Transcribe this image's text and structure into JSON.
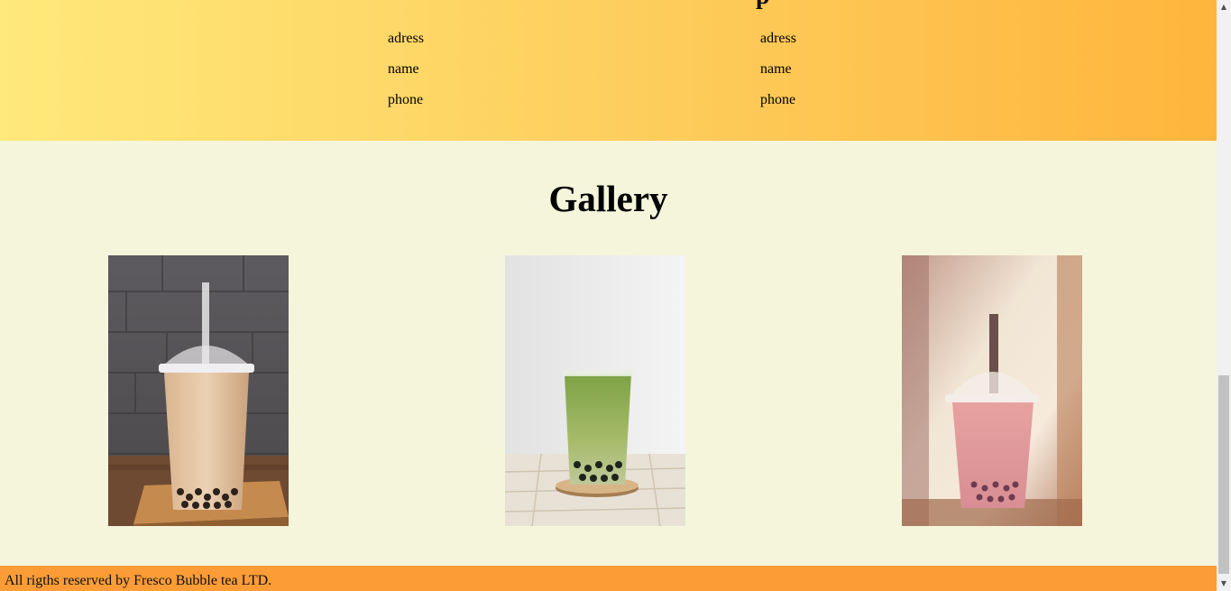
{
  "locations": {
    "heading_fragment": "p",
    "left": {
      "adress": "adress",
      "name": "name",
      "phone": "phone"
    },
    "right": {
      "adress": "adress",
      "name": "name",
      "phone": "phone"
    }
  },
  "gallery": {
    "title": "Gallery",
    "photos": [
      {
        "alt": "Milk tea bubble tea"
      },
      {
        "alt": "Matcha bubble tea"
      },
      {
        "alt": "Strawberry bubble tea"
      }
    ]
  },
  "footer": {
    "text": "All rigths reserved by Fresco Bubble tea LTD."
  },
  "colors": {
    "page_bg": "#f5f5dc",
    "footer_bg": "#fb9c37",
    "band_start": "#ffe97a",
    "band_end": "#ffb53d"
  }
}
